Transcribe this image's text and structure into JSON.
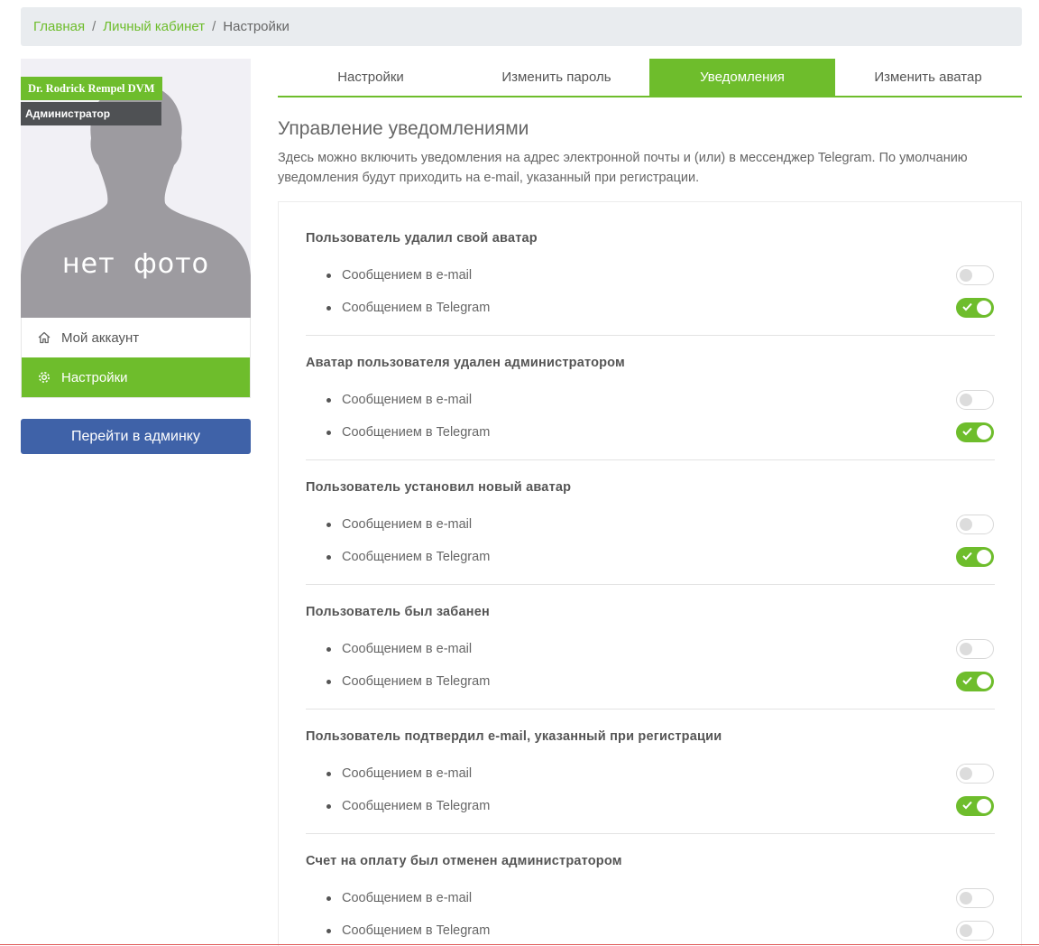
{
  "breadcrumb": {
    "items": [
      "Главная",
      "Личный кабинет"
    ],
    "separator": "/",
    "current": "Настройки"
  },
  "profile": {
    "name": "Dr. Rodrick Rempel DVM",
    "role": "Администратор",
    "no_photo": "нет  фото"
  },
  "sidebar": {
    "items": [
      {
        "label": "Мой аккаунт",
        "icon": "home-icon",
        "active": false
      },
      {
        "label": "Настройки",
        "icon": "gear-icon",
        "active": true
      }
    ],
    "admin_button": "Перейти в админку"
  },
  "tabs": [
    {
      "label": "Настройки",
      "active": false
    },
    {
      "label": "Изменить пароль",
      "active": false
    },
    {
      "label": "Уведомления",
      "active": true
    },
    {
      "label": "Изменить аватар",
      "active": false
    }
  ],
  "section": {
    "title": "Управление уведомлениями",
    "description": "Здесь можно включить уведомления на адрес электронной почты и (или) в мессенджер Telegram. По умолчанию уведомления будут приходить на e-mail, указанный при регистрации."
  },
  "groups": [
    {
      "title": "Пользователь удалил свой аватар",
      "options": [
        {
          "label": "Сообщением в e-mail",
          "enabled": false
        },
        {
          "label": "Сообщением в Telegram",
          "enabled": true
        }
      ]
    },
    {
      "title": "Аватар пользователя удален администратором",
      "options": [
        {
          "label": "Сообщением в e-mail",
          "enabled": false
        },
        {
          "label": "Сообщением в Telegram",
          "enabled": true
        }
      ]
    },
    {
      "title": "Пользователь установил новый аватар",
      "options": [
        {
          "label": "Сообщением в e-mail",
          "enabled": false
        },
        {
          "label": "Сообщением в Telegram",
          "enabled": true
        }
      ]
    },
    {
      "title": "Пользователь был забанен",
      "options": [
        {
          "label": "Сообщением в e-mail",
          "enabled": false
        },
        {
          "label": "Сообщением в Telegram",
          "enabled": true
        }
      ]
    },
    {
      "title": "Пользователь подтвердил e-mail, указанный при регистрации",
      "options": [
        {
          "label": "Сообщением в e-mail",
          "enabled": false
        },
        {
          "label": "Сообщением в Telegram",
          "enabled": true
        }
      ]
    },
    {
      "title": "Счет на оплату был отменен администратором",
      "options": [
        {
          "label": "Сообщением в e-mail",
          "enabled": false
        },
        {
          "label": "Сообщением в Telegram",
          "enabled": false
        }
      ]
    }
  ],
  "colors": {
    "accent": "#6ebd2c",
    "admin_button": "#3f62a8",
    "breadcrumb_bg": "#e9ecef"
  }
}
